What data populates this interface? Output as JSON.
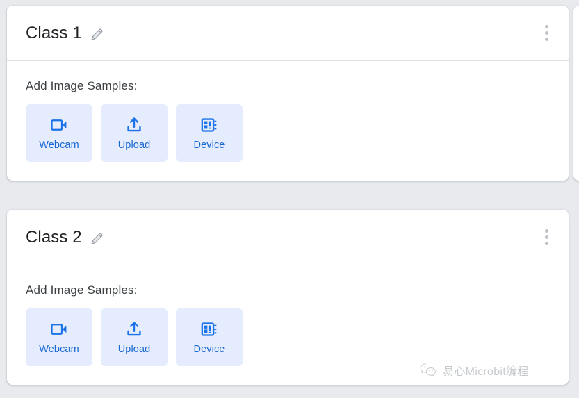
{
  "background_color": "#e8eaed",
  "card_color": "#ffffff",
  "accent_color": "#1a73e8",
  "button_bg_color": "#e4ecfd",
  "button_text_color": "#1967d2",
  "title_color": "#202124",
  "label_color": "#3c4043",
  "kebab_color": "#bdc1c6",
  "classes": [
    {
      "title": "Class 1",
      "edit_icon": "pencil-icon",
      "menu_icon": "kebab-menu-icon",
      "samples_label": "Add Image Samples:",
      "buttons": [
        {
          "label": "Webcam",
          "icon": "webcam-icon"
        },
        {
          "label": "Upload",
          "icon": "upload-icon"
        },
        {
          "label": "Device",
          "icon": "device-chip-icon"
        }
      ]
    },
    {
      "title": "Class 2",
      "edit_icon": "pencil-icon",
      "menu_icon": "kebab-menu-icon",
      "samples_label": "Add Image Samples:",
      "buttons": [
        {
          "label": "Webcam",
          "icon": "webcam-icon"
        },
        {
          "label": "Upload",
          "icon": "upload-icon"
        },
        {
          "label": "Device",
          "icon": "device-chip-icon"
        }
      ]
    }
  ],
  "watermark": {
    "icon": "wechat-icon",
    "text": "易心Microbit编程"
  }
}
